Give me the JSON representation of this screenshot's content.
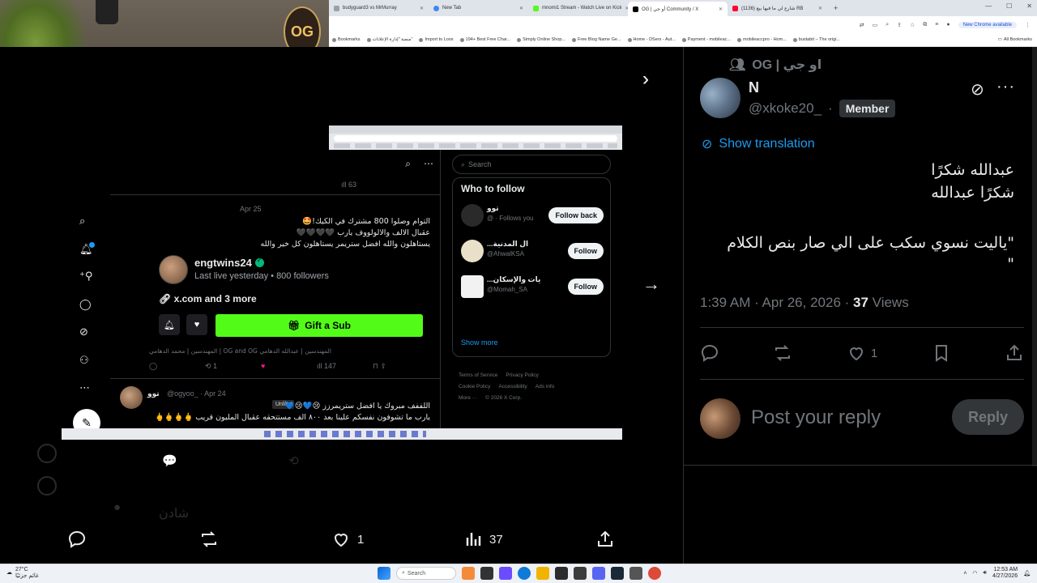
{
  "browser": {
    "tabs": [
      {
        "label": "budyguard3 vs MrMurray",
        "icon": "generic-tab-icon",
        "color": "#9aa0a6"
      },
      {
        "label": "New Tab",
        "icon": "chrome-icon",
        "color": "#4285f4"
      },
      {
        "label": "mnomi1 Stream - Watch Live on Kick",
        "icon": "kick-icon",
        "color": "#53fc18"
      },
      {
        "label": "OG | أو جي Community / X",
        "icon": "x-icon",
        "color": "#000000",
        "active": true
      },
      {
        "label": "(1136) شارع لي ما فيها بيع RB",
        "icon": "youtube-icon",
        "color": "#ff0033"
      }
    ],
    "update_pill": "New Chrome available",
    "bookmarks": [
      "Bookmarks",
      "منصة \"إدارة الإعلانات\"",
      "Import to Loox",
      "194+ Best Free Char...",
      "Simply Online Shop...",
      "Free Blog Name Ge...",
      "Home - DSers - Aut...",
      "Payment - mobileac...",
      "mobileaccpro - Hom...",
      "bustabit – The origi..."
    ],
    "all_bookmarks": "All Bookmarks"
  },
  "webcam": {
    "logo": "OG",
    "logo_arc": "TOO OLD TO DIE · TOO YOUNG"
  },
  "embedded": {
    "metric_top": "63",
    "tweet1": {
      "date": "Apr 25",
      "lines": [
        "التوام وصلوا 800 مشترك في الكيك!🤩",
        "عقبال الالف والالولووف يارب 🖤🖤🖤🖤",
        "يستاهلون والله افضل ستريمر يستاهلون كل خير والله"
      ]
    },
    "profile": {
      "name": "engtwins24",
      "sub": "Last live yesterday • 800 followers",
      "link": "x.com and 3 more",
      "gift": "Gift a Sub"
    },
    "tweet1_footer": "المهندسين | عبدالله الدهامي OG and OG | المهندسين | محمد الدهامي",
    "tweet1_actions": {
      "retweets": "1",
      "views": "147"
    },
    "unlike_tip": "Unlike",
    "tweet2": {
      "name": "توو",
      "meta": "@ogyoo_ · Apr 24",
      "lines": [
        "اللففف مبروك يا افضل ستريمرزز 😢💙😢💙",
        "يارب ما تشوفون نفسكم علينا بعد ٨٠٠ الف مستتحقه عقبال المليون قريب 🖕🖕🖕🖕"
      ]
    },
    "search_placeholder": "Search",
    "who_to_follow": "Who to follow",
    "follow_rows": [
      {
        "name": "توو",
        "handle": "@ · Follows you",
        "button": "Follow back"
      },
      {
        "name": "...ال المدنية",
        "handle": "@AhwalKSA",
        "button": "Follow"
      },
      {
        "name": "...يات والإسكان",
        "handle": "@Momah_SA",
        "button": "Follow"
      }
    ],
    "show_more": "Show more",
    "legal": [
      "Terms of Service",
      "Privacy Policy",
      "Cookie Policy",
      "Accessibility",
      "Ads info",
      "More ···",
      "© 2026 X Corp."
    ]
  },
  "stream_bottom": {
    "likes": "1",
    "views": "37"
  },
  "post": {
    "community": "OG | او جي",
    "name": "N",
    "handle": "@xkoke20_",
    "badge": "Member",
    "show_translation": "Show translation",
    "line1": "عبدالله شكرًا",
    "line2": "شكرًا عبدالله",
    "line3": "\"ياليت نسوي سكب على الي صار بنص الكلام",
    "line4": "\"",
    "time": "1:39 AM · Apr 26, 2026 · ",
    "views": "37",
    "views_label": " Views",
    "likes": "1",
    "reply_placeholder": "Post your reply",
    "reply_button": "Reply"
  },
  "taskbar": {
    "weather_temp": "27°C",
    "weather_desc": "غائم جزئيًا",
    "search": "Search",
    "time": "12:53 AM",
    "date": "4/27/2026"
  }
}
